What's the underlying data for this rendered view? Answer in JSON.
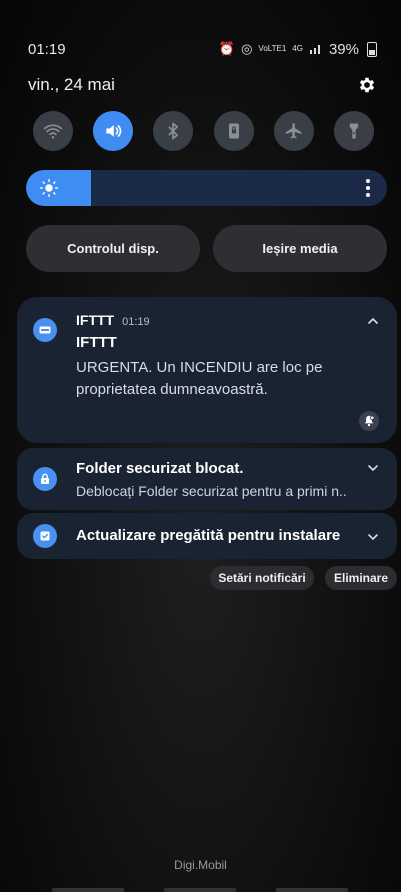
{
  "status_bar": {
    "time": "01:19",
    "network_small": "VoLTE1",
    "network_type": "4G",
    "battery": "39%"
  },
  "header": {
    "date": "vin., 24 mai"
  },
  "quick_settings": [
    {
      "icon": "wifi-icon",
      "active": false
    },
    {
      "icon": "sound-icon",
      "active": true
    },
    {
      "icon": "bluetooth-icon",
      "active": false
    },
    {
      "icon": "portrait-lock-icon",
      "active": false
    },
    {
      "icon": "airplane-icon",
      "active": false
    },
    {
      "icon": "flashlight-icon",
      "active": false
    }
  ],
  "brightness": {
    "level": 0.18
  },
  "buttons": {
    "device_control": "Controlul disp.",
    "media_output": "Ieșire media"
  },
  "notifications": {
    "ifttt": {
      "app": "IFTTT",
      "time": "01:19",
      "title": "IFTTT",
      "body": "URGENTA. Un INCENDIU are loc pe proprietatea dumneavoastră."
    },
    "secure_folder": {
      "title": "Folder securizat blocat.",
      "body": "Deblocați Folder securizat pentru a primi n.."
    },
    "update": {
      "title": "Actualizare pregătită pentru instalare"
    }
  },
  "actions": {
    "settings": "Setări notificări",
    "clear": "Eliminare"
  },
  "carrier": "Digi.Mobil",
  "colors": {
    "accent": "#3f8df3",
    "card": "#1a2332",
    "tile_inactive": "#3a3f47"
  }
}
